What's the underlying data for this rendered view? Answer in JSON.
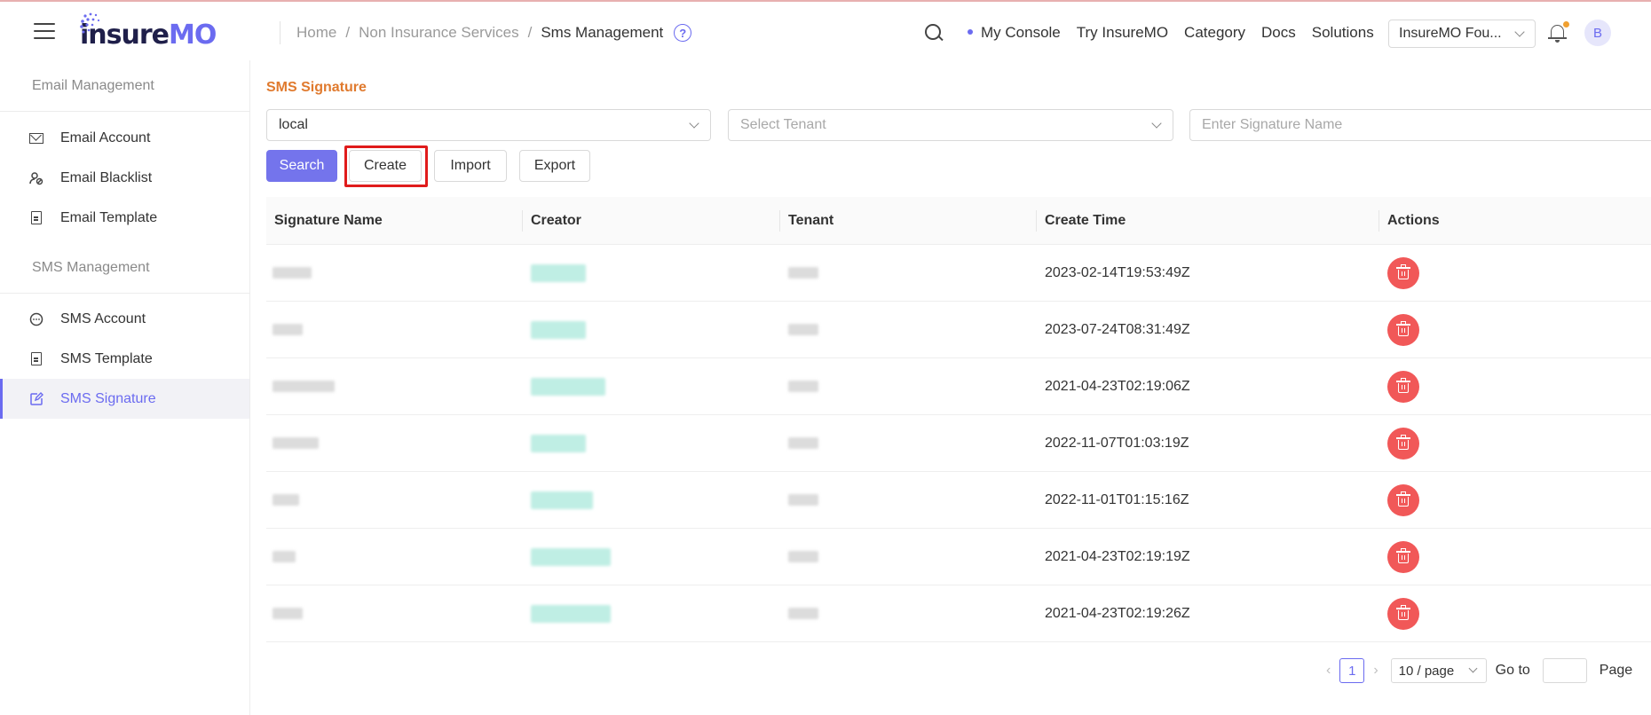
{
  "header": {
    "logo_prefix": "insure",
    "logo_suffix": "MO",
    "breadcrumb": [
      "Home",
      "Non Insurance Services",
      "Sms Management"
    ],
    "help_symbol": "?",
    "top_links": [
      "My Console",
      "Try InsureMO",
      "Category",
      "Docs",
      "Solutions"
    ],
    "tenant_select": "InsureMO Fou...",
    "avatar_letter": "B"
  },
  "sidebar": {
    "groups": [
      {
        "label": "Email Management",
        "items": [
          {
            "label": "Email Account",
            "icon": "mail-icon"
          },
          {
            "label": "Email Blacklist",
            "icon": "user-block-icon"
          },
          {
            "label": "Email Template",
            "icon": "document-icon"
          }
        ]
      },
      {
        "label": "SMS Management",
        "items": [
          {
            "label": "SMS Account",
            "icon": "chat-icon"
          },
          {
            "label": "SMS Template",
            "icon": "document-icon"
          },
          {
            "label": "SMS Signature",
            "icon": "edit-icon",
            "active": true
          }
        ]
      }
    ]
  },
  "main": {
    "title": "SMS Signature",
    "filters": {
      "environment": "local",
      "tenant_placeholder": "Select Tenant",
      "signature_placeholder": "Enter Signature Name"
    },
    "buttons": {
      "search": "Search",
      "create": "Create",
      "import": "Import",
      "export": "Export"
    },
    "table": {
      "columns": [
        "Signature Name",
        "Creator",
        "Tenant",
        "Create Time",
        "Actions"
      ],
      "rows": [
        {
          "create_time": "2023-02-14T19:53:49Z"
        },
        {
          "create_time": "2023-07-24T08:31:49Z"
        },
        {
          "create_time": "2021-04-23T02:19:06Z"
        },
        {
          "create_time": "2022-11-07T01:03:19Z"
        },
        {
          "create_time": "2022-11-01T01:15:16Z"
        },
        {
          "create_time": "2021-04-23T02:19:19Z"
        },
        {
          "create_time": "2021-04-23T02:19:26Z"
        }
      ]
    },
    "pagination": {
      "current_page": "1",
      "page_size": "10 / page",
      "goto_label": "Go to",
      "page_label": "Page"
    }
  },
  "colors": {
    "accent": "#6b6bf0",
    "title_orange": "#e07a2e",
    "delete_red": "#f15858",
    "highlight_red": "#e01b1b"
  }
}
